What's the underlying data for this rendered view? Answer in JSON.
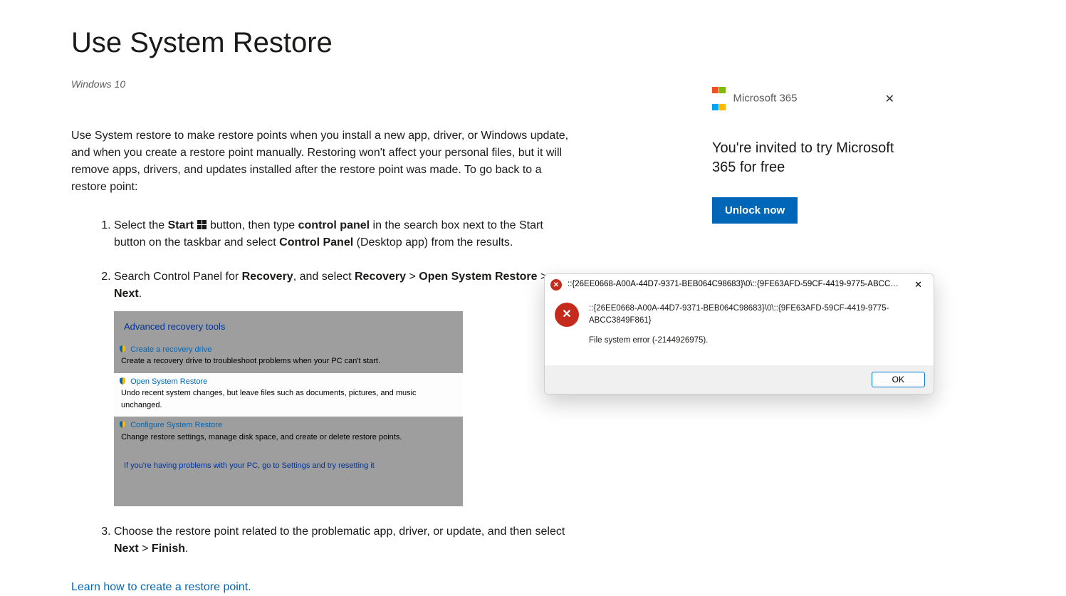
{
  "page": {
    "title": "Use System Restore",
    "applies_to": "Windows 10",
    "intro": "Use System restore to make restore points when you install a new app, driver, or Windows update, and when you create a restore point manually. Restoring won't affect your personal files, but it will remove apps, drivers, and updates installed after the restore point was made. To go back to a restore point:",
    "learn_link": "Learn how to create a restore point."
  },
  "steps": {
    "s1": {
      "t1": "Select the ",
      "start": "Start",
      "t2": " button, then type ",
      "cp": "control panel",
      "t3": " in the search box next to the Start button on the taskbar and select ",
      "cp2": "Control Panel",
      "t4": " (Desktop app) from the results."
    },
    "s2": {
      "t1": "Search Control Panel for ",
      "rec": "Recovery",
      "t2": ", and select ",
      "rec2": "Recovery",
      "gt1": " > ",
      "osr": "Open System Restore",
      "gt2": " > ",
      "nxt": "Next",
      "t3": "."
    },
    "s3": {
      "t1": "Choose the restore point related to the problematic app, driver, or update, and then select ",
      "nxt": "Next",
      "gt": " > ",
      "fin": "Finish",
      "t2": "."
    }
  },
  "recovery": {
    "heading": "Advanced recovery tools",
    "items": [
      {
        "title": "Create a recovery drive",
        "desc": "Create a recovery drive to troubleshoot problems when your PC can't start."
      },
      {
        "title": "Open System Restore",
        "desc": "Undo recent system changes, but leave files such as documents, pictures, and music unchanged."
      },
      {
        "title": "Configure System Restore",
        "desc": "Change restore settings, manage disk space, and create or delete restore points."
      }
    ],
    "hint": "If you're having problems with your PC, go to Settings and try resetting it"
  },
  "promo": {
    "brand": "Microsoft 365",
    "text": "You're invited to try Microsoft 365 for free",
    "button": "Unlock now"
  },
  "dialog": {
    "title": "::{26EE0668-A00A-44D7-9371-BEB064C98683}\\0\\::{9FE63AFD-59CF-4419-9775-ABCC3849F...",
    "line1": "::{26EE0668-A00A-44D7-9371-BEB064C98683}\\0\\::{9FE63AFD-59CF-4419-9775-ABCC3849F861}",
    "line2": "File system error (-2144926975).",
    "ok": "OK"
  }
}
